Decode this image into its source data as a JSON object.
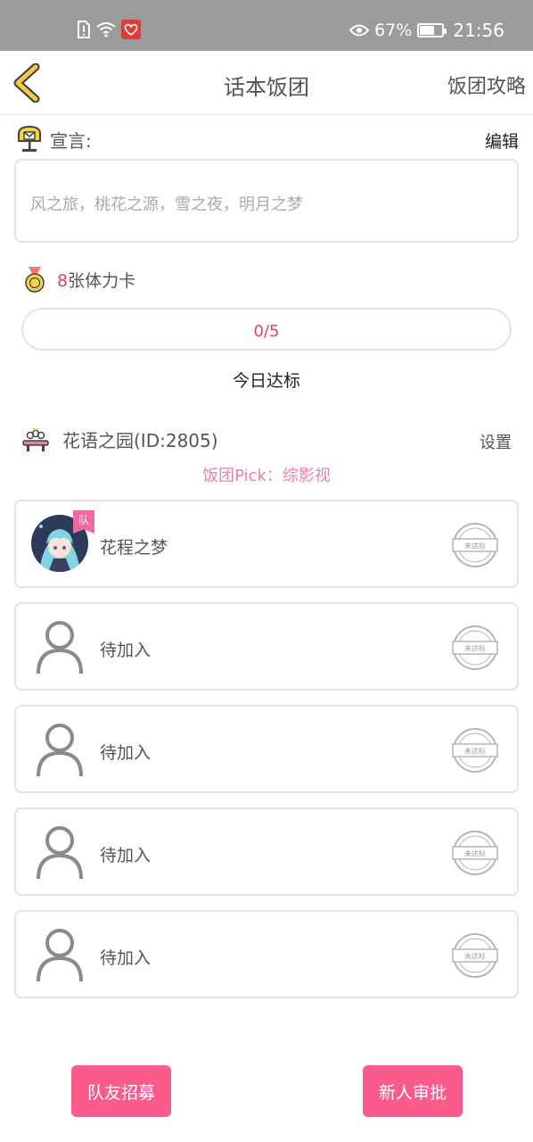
{
  "status_bar": {
    "battery_percent": "67%",
    "battery_level": 0.67,
    "time": "21:56",
    "icons": [
      "sim-alert-icon",
      "wifi-icon",
      "app-notification-icon",
      "eye-icon",
      "battery-icon"
    ]
  },
  "header": {
    "title": "话本饭团",
    "right_link": "饭团攻略",
    "back_icon": "chevron-left-icon"
  },
  "declaration": {
    "label": "宣言:",
    "edit_label": "编辑",
    "text": "风之旅，桃花之源，雪之夜，明月之梦"
  },
  "stamina": {
    "count": "8",
    "label": "张体力卡",
    "progress_text": "0/5",
    "progress_value": 0,
    "progress_max": 5,
    "status_text": "今日达标"
  },
  "group": {
    "name": "花语之园(ID:2805)",
    "settings_label": "设置",
    "pick_text": "饭团Pick：综影视"
  },
  "members": [
    {
      "name": "花程之梦",
      "captain_tag": "队",
      "stamp": "未达标",
      "is_placeholder": false
    },
    {
      "name": "待加入",
      "stamp": "未达标",
      "is_placeholder": true
    },
    {
      "name": "待加入",
      "stamp": "未达标",
      "is_placeholder": true
    },
    {
      "name": "待加入",
      "stamp": "未达标",
      "is_placeholder": true
    },
    {
      "name": "待加入",
      "stamp": "未达标",
      "is_placeholder": true
    }
  ],
  "actions": {
    "recruit_label": "队友招募",
    "review_label": "新人审批"
  },
  "colors": {
    "accent_pink": "#fb5a8d",
    "pick_pink": "#ef7fa3",
    "count_red": "#e0465d",
    "status_bar_gray": "#9b9b9b",
    "back_arrow_yellow": "#f2c744"
  }
}
